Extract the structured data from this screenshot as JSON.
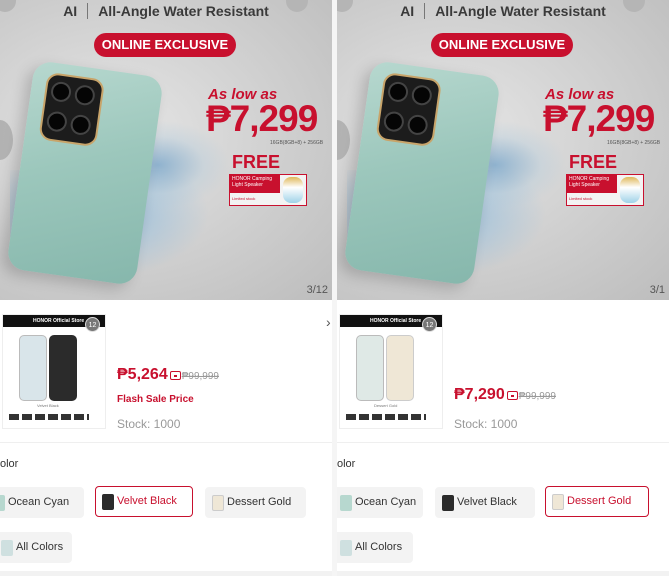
{
  "banner": {
    "ai_text": "AI",
    "headline": "All-Angle Water Resistant",
    "exclusive": "ONLINE EXCLUSIVE",
    "as_low_as": "As low as",
    "price": "₱7,299",
    "spec": "16GB(8GB+8) + 256GB",
    "free": "FREE",
    "gift_title": "HONOR Camping Light Speaker",
    "gift_sub": "Limited stock",
    "pager": [
      "3/12",
      "3/1"
    ]
  },
  "variants": [
    {
      "thumb_store": "HONOR Official Store",
      "thumb_badge": "12",
      "thumb_caption": "Velvet Black",
      "price": "₱5,264",
      "old_price": "₱99,999",
      "flash_label": "Flash Sale Price",
      "stock": "Stock: 1000",
      "phone_colors": [
        "#d9e5ea",
        "#2b2b2b"
      ]
    },
    {
      "thumb_store": "HONOR Official Store",
      "thumb_badge": "12",
      "thumb_caption": "Dessert Gold",
      "price": "₱7,290",
      "old_price": "₱99,999",
      "flash_label": "",
      "stock": "Stock: 1000",
      "phone_colors": [
        "#dfe9e6",
        "#efe7d6"
      ]
    }
  ],
  "color_section": {
    "label": "olor",
    "options": [
      "Ocean Cyan",
      "Velvet Black",
      "Dessert Gold",
      "All Colors"
    ],
    "selected": [
      "Velvet Black",
      "Dessert Gold"
    ],
    "accent": "#c8102e"
  },
  "chevron": "›"
}
